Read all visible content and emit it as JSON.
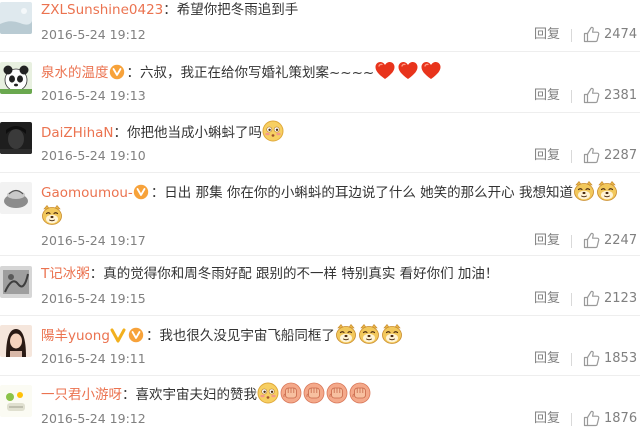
{
  "ui": {
    "reply_label": "回复",
    "colors": {
      "username": "#eb7350",
      "text": "#333333",
      "meta": "#808080"
    }
  },
  "comments": [
    {
      "username": "ZXLSunshine0423",
      "text": "：希望你把冬雨追到手",
      "time": "2016-5-24 19:12",
      "likes": "2474"
    },
    {
      "username": "泉水的温度",
      "text": "：六叔，我正在给你写婚礼策划案~~~~",
      "time": "2016-5-24 19:13",
      "likes": "2381"
    },
    {
      "username": "DaiZHihaN",
      "text": "：你把他当成小蝌蚪了吗",
      "time": "2016-5-24 19:10",
      "likes": "2287"
    },
    {
      "username": "Gaomoumou-",
      "text": "：日出  那集 你在你的小蝌蚪的耳边说了什么 她笑的那么开心 我想知道",
      "time": "2016-5-24 19:17",
      "likes": "2247"
    },
    {
      "username": "T记冰粥",
      "text": "：真的觉得你和周冬雨好配 跟别的不一样 特别真实 看好你们 加油！",
      "time": "2016-5-24 19:15",
      "likes": "2123"
    },
    {
      "username": "陽羊yuong",
      "text": "：我也很久没见宇宙飞船同框了",
      "time": "2016-5-24 19:11",
      "likes": "1853"
    },
    {
      "username": "一只君小游呀",
      "text": "：喜欢宇宙夫妇的赞我",
      "time": "2016-5-24 19:12",
      "likes": "1876"
    }
  ]
}
